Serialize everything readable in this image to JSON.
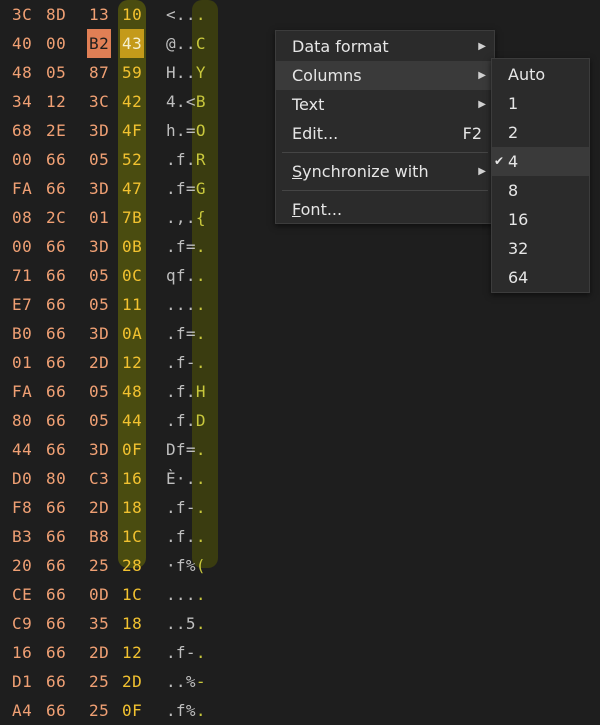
{
  "hex_rows": [
    {
      "b": [
        "3C",
        "8D",
        "13",
        "10"
      ],
      "ascii": "<..."
    },
    {
      "b": [
        "40",
        "00",
        "B2",
        "43"
      ],
      "ascii": "@..C"
    },
    {
      "b": [
        "48",
        "05",
        "87",
        "59"
      ],
      "ascii": "H..Y"
    },
    {
      "b": [
        "34",
        "12",
        "3C",
        "42"
      ],
      "ascii": "4.<B"
    },
    {
      "b": [
        "68",
        "2E",
        "3D",
        "4F"
      ],
      "ascii": "h.=O"
    },
    {
      "b": [
        "00",
        "66",
        "05",
        "52"
      ],
      "ascii": ".f.R"
    },
    {
      "b": [
        "FA",
        "66",
        "3D",
        "47"
      ],
      "ascii": ".f=G"
    },
    {
      "b": [
        "08",
        "2C",
        "01",
        "7B"
      ],
      "ascii": ".,.{"
    },
    {
      "b": [
        "00",
        "66",
        "3D",
        "0B"
      ],
      "ascii": ".f=."
    },
    {
      "b": [
        "71",
        "66",
        "05",
        "0C"
      ],
      "ascii": "qf.."
    },
    {
      "b": [
        "E7",
        "66",
        "05",
        "11"
      ],
      "ascii": "...."
    },
    {
      "b": [
        "B0",
        "66",
        "3D",
        "0A"
      ],
      "ascii": ".f=."
    },
    {
      "b": [
        "01",
        "66",
        "2D",
        "12"
      ],
      "ascii": ".f-."
    },
    {
      "b": [
        "FA",
        "66",
        "05",
        "48"
      ],
      "ascii": ".f.H"
    },
    {
      "b": [
        "80",
        "66",
        "05",
        "44"
      ],
      "ascii": ".f.D"
    },
    {
      "b": [
        "44",
        "66",
        "3D",
        "0F"
      ],
      "ascii": "Df=."
    },
    {
      "b": [
        "D0",
        "80",
        "C3",
        "16"
      ],
      "ascii": "È·.."
    },
    {
      "b": [
        "F8",
        "66",
        "2D",
        "18"
      ],
      "ascii": ".f-."
    },
    {
      "b": [
        "B3",
        "66",
        "B8",
        "1C"
      ],
      "ascii": ".f.."
    },
    {
      "b": [
        "20",
        "66",
        "25",
        "28"
      ],
      "ascii": "·f%("
    },
    {
      "b": [
        "CE",
        "66",
        "0D",
        "1C"
      ],
      "ascii": "...."
    },
    {
      "b": [
        "C9",
        "66",
        "35",
        "18"
      ],
      "ascii": "..5."
    },
    {
      "b": [
        "16",
        "66",
        "2D",
        "12"
      ],
      "ascii": ".f-."
    },
    {
      "b": [
        "D1",
        "66",
        "25",
        "2D"
      ],
      "ascii": "..%-"
    },
    {
      "b": [
        "A4",
        "66",
        "25",
        "0F"
      ],
      "ascii": ".f%."
    }
  ],
  "context_menu": {
    "items": [
      {
        "label": "Data format",
        "shortcut": "",
        "arrow": "▶"
      },
      {
        "label": "Columns",
        "shortcut": "",
        "arrow": "▶"
      },
      {
        "label": "Text",
        "shortcut": "",
        "arrow": "▶"
      },
      {
        "label": "Edit...",
        "shortcut": "F2",
        "arrow": ""
      },
      {
        "label": "Synchronize with",
        "shortcut": "",
        "arrow": "▶"
      },
      {
        "label": "Font...",
        "shortcut": "",
        "arrow": ""
      }
    ]
  },
  "columns_submenu": {
    "options": [
      "Auto",
      "1",
      "2",
      "4",
      "8",
      "16",
      "32",
      "64"
    ],
    "selected": "4",
    "check_glyph": "✔"
  },
  "colors": {
    "background": "#1e1e1e",
    "hex_text": "#f0a074",
    "highlight_column": "#4a4c10",
    "menu_bg": "#2b2b2b"
  }
}
